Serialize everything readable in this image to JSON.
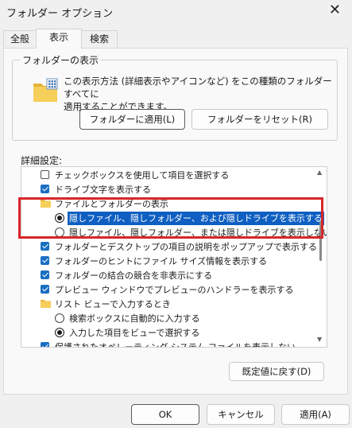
{
  "window": {
    "title": "フォルダー オプション"
  },
  "tabs": [
    {
      "label": "全般"
    },
    {
      "label": "表示"
    },
    {
      "label": "検索"
    }
  ],
  "folder_views": {
    "group_label": "フォルダーの表示",
    "description_line1": "この表示方法 (詳細表示やアイコンなど) をこの種類のフォルダーすべてに",
    "description_line2": "適用することができます。",
    "apply_button": "フォルダーに適用(L)",
    "reset_button": "フォルダーをリセット(R)"
  },
  "advanced": {
    "label": "詳細設定:",
    "items": [
      {
        "text": "チェックボックスを使用して項目を選択する",
        "kind": "checkbox",
        "checked": false
      },
      {
        "text": "ドライブ文字を表示する",
        "kind": "checkbox",
        "checked": true
      },
      {
        "text": "ファイルとフォルダーの表示",
        "kind": "folder"
      },
      {
        "text": "隠しファイル、隠しフォルダー、および隠しドライブを表示する",
        "kind": "radio",
        "selected": true
      },
      {
        "text": "隠しファイル、隠しフォルダー、または隠しドライブを表示しない",
        "kind": "radio",
        "selected": false
      },
      {
        "text": "フォルダーとデスクトップの項目の説明をポップアップで表示する",
        "kind": "checkbox",
        "checked": true
      },
      {
        "text": "フォルダーのヒントにファイル サイズ情報を表示する",
        "kind": "checkbox",
        "checked": true
      },
      {
        "text": "フォルダーの結合の競合を非表示にする",
        "kind": "checkbox",
        "checked": true
      },
      {
        "text": "プレビュー ウィンドウでプレビューのハンドラーを表示する",
        "kind": "checkbox",
        "checked": true
      },
      {
        "text": "リスト ビューで入力するとき",
        "kind": "folder"
      },
      {
        "text": "検索ボックスに自動的に入力する",
        "kind": "radio",
        "selected": false
      },
      {
        "text": "入力した項目をビューで選択する",
        "kind": "radio",
        "selected": true
      },
      {
        "text": "保護されたオペレーティング システム ファイルを表示しない",
        "kind": "checkbox",
        "checked": true
      }
    ],
    "restore_button": "既定値に戻す(D)"
  },
  "footer": {
    "ok": "OK",
    "cancel": "キャンセル",
    "apply": "適用(A)"
  },
  "colors": {
    "accent": "#0f5fc2",
    "highlight_box": "#d9262b",
    "folder": "#f2c94c"
  }
}
